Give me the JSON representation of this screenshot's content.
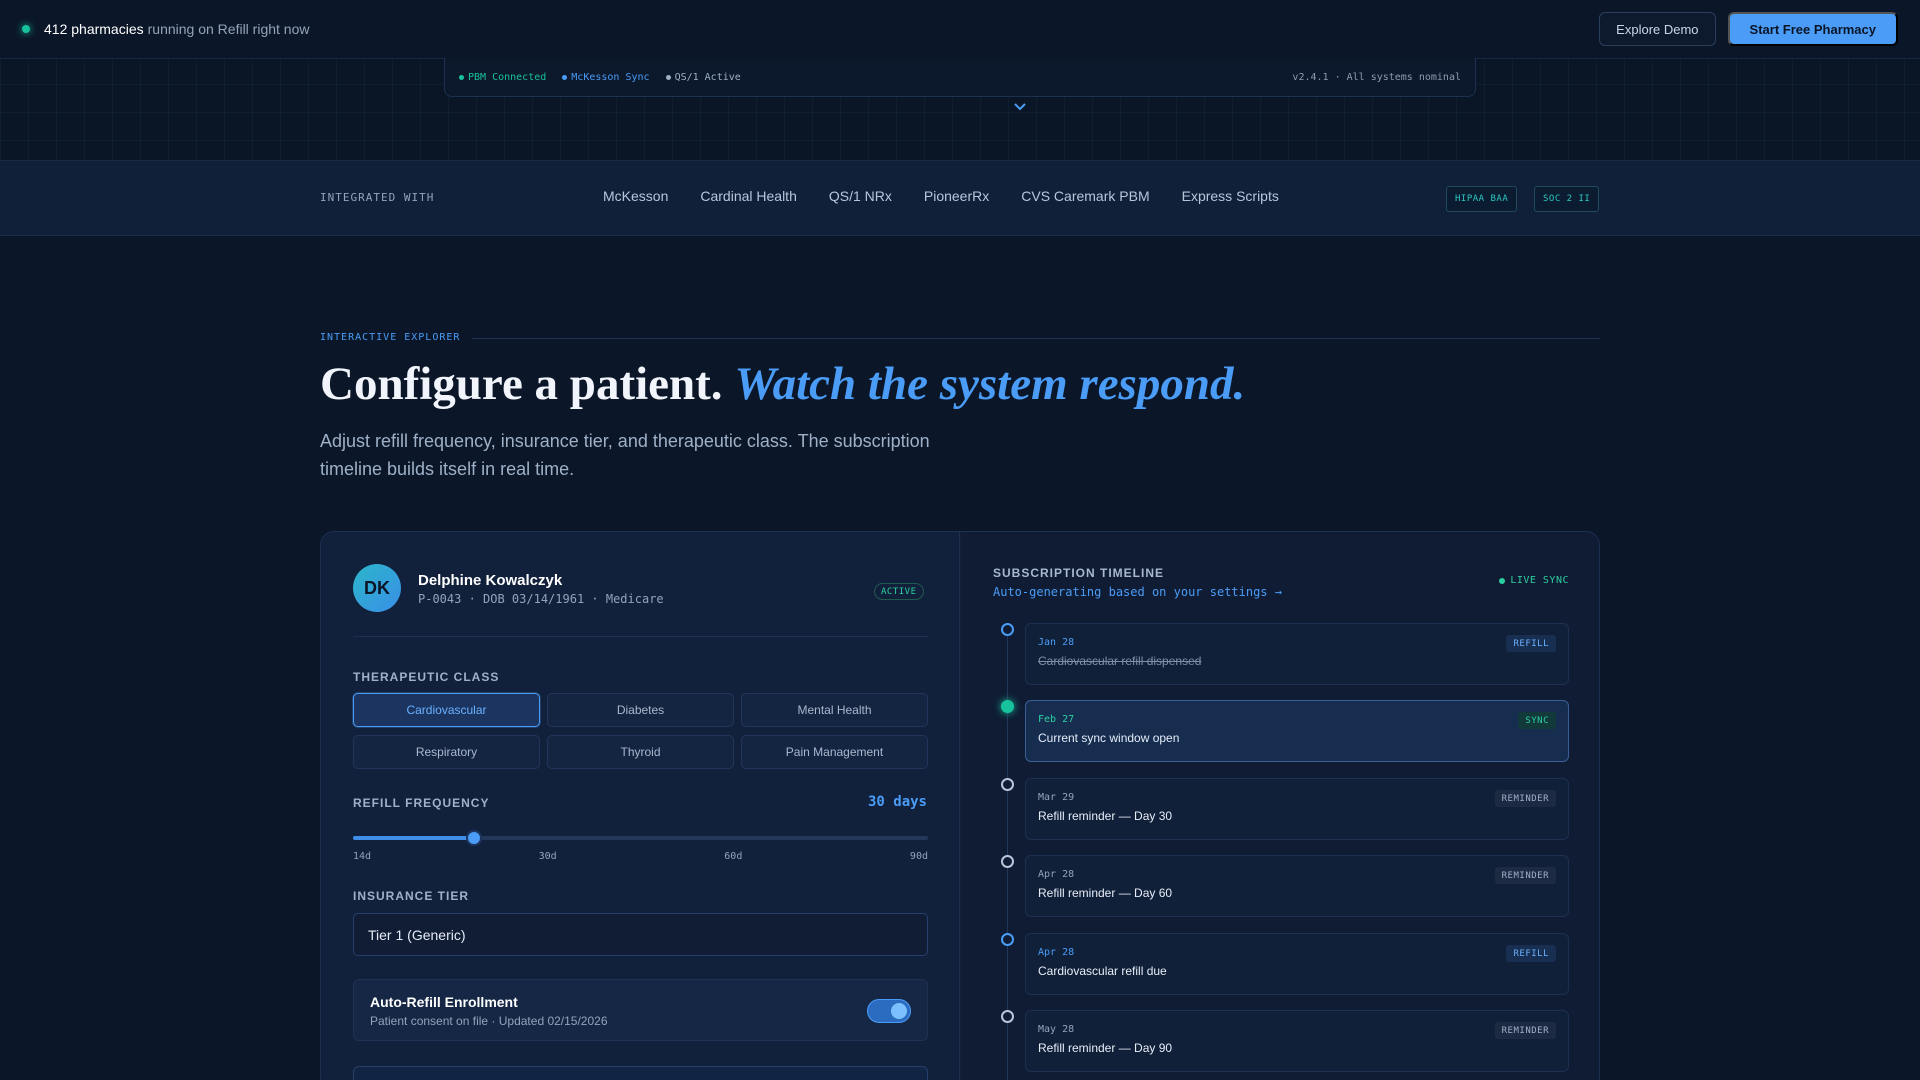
{
  "topbar": {
    "count": "412 pharmacies",
    "count_rest": "running on Refill right now",
    "demo_button": "Explore Demo",
    "start_button": "Start Free Pharmacy"
  },
  "console": {
    "items": [
      {
        "label": "PBM Connected",
        "color": "#18c29c"
      },
      {
        "label": "McKesson Sync",
        "color": "#4a9cf7"
      },
      {
        "label": "QS/1 Active",
        "color": "#9fb0c8"
      }
    ],
    "version": "v2.4.1 · All systems nominal"
  },
  "integrations": {
    "label": "INTEGRATED WITH",
    "partners": [
      "McKesson",
      "Cardinal Health",
      "QS/1 NRx",
      "PioneerRx",
      "CVS Caremark PBM",
      "Express Scripts"
    ],
    "badges": [
      "HIPAA BAA",
      "SOC 2 II"
    ]
  },
  "section": {
    "eyebrow": "INTERACTIVE EXPLORER",
    "headline_plain": "Configure a patient.",
    "headline_italic": "Watch the system respond.",
    "subtitle": "Adjust refill frequency, insurance tier, and therapeutic class. The subscription timeline builds itself in real time."
  },
  "patient": {
    "initials": "DK",
    "name": "Delphine Kowalczyk",
    "meta": "P-0043 · DOB 03/14/1961 · Medicare",
    "status": "ACTIVE"
  },
  "controls": {
    "class_label": "THERAPEUTIC CLASS",
    "classes": [
      "Cardiovascular",
      "Diabetes",
      "Mental Health",
      "Respiratory",
      "Thyroid",
      "Pain Management"
    ],
    "selected_class": "Cardiovascular",
    "freq_label": "REFILL FREQUENCY",
    "freq_value": "30 days",
    "freq_days": 30,
    "freq_min": 14,
    "freq_max": 90,
    "freq_ticks": [
      "14d",
      "30d",
      "60d",
      "90d"
    ],
    "tier_label": "INSURANCE TIER",
    "tier_value": "Tier 1 (Generic)",
    "auto_refill_title": "Auto-Refill Enrollment",
    "auto_refill_sub": "Patient consent on file · Updated 02/15/2026",
    "auto_refill_on": true
  },
  "timeline": {
    "title": "SUBSCRIPTION TIMELINE",
    "subtitle": "Auto-generating based on your settings →",
    "live": "LIVE SYNC",
    "events": [
      {
        "date": "Jan 28",
        "text": "Cardiovascular refill dispensed",
        "tag": "REFILL",
        "kind": "refill",
        "done": true
      },
      {
        "date": "Feb 27",
        "text": "Current sync window open",
        "tag": "SYNC",
        "kind": "sync",
        "current": true
      },
      {
        "date": "Mar 29",
        "text": "Refill reminder — Day 30",
        "tag": "REMINDER",
        "kind": "reminder"
      },
      {
        "date": "Apr 28",
        "text": "Refill reminder — Day 60",
        "tag": "REMINDER",
        "kind": "reminder"
      },
      {
        "date": "Apr 28",
        "text": "Cardiovascular refill due",
        "tag": "REFILL",
        "kind": "refill"
      },
      {
        "date": "May 28",
        "text": "Refill reminder — Day 90",
        "tag": "REMINDER",
        "kind": "reminder"
      }
    ]
  }
}
